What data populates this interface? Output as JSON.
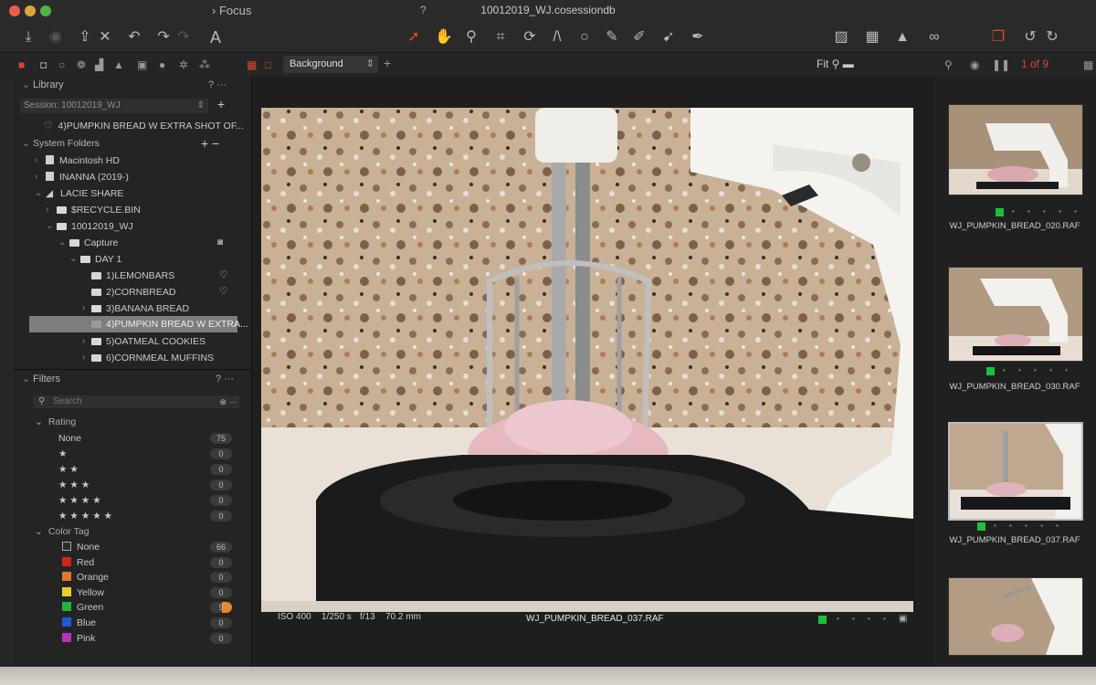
{
  "window": {
    "title": "10012019_WJ.cosessiondb",
    "focus_label": "Focus",
    "help": "?"
  },
  "toolbar": {
    "icons": [
      "import-icon",
      "camera-icon",
      "export-icon",
      "delete-icon",
      "undo-icon",
      "redo-icon",
      "text-icon",
      "select-cursor-icon",
      "pan-hand-icon",
      "zoom-icon",
      "crop-icon",
      "rotate-icon",
      "keystone-icon",
      "spot-icon",
      "brush-icon",
      "eraser-icon",
      "gradient-icon",
      "pick-icon",
      "overlay-icon",
      "grid-icon",
      "warning-icon",
      "proof-icon",
      "variants-icon",
      "rotate-left-icon",
      "rotate-right-icon"
    ]
  },
  "subbar": {
    "layer": "Background",
    "fit": "Fit",
    "counter": "1 of 9"
  },
  "library": {
    "title": "Library",
    "session": "Session: 10012019_WJ",
    "favorite": "4)PUMPKIN BREAD W EXTRA SHOT OF...",
    "system_folders": "System Folders",
    "tree": [
      {
        "label": "Macintosh HD",
        "kind": "disk"
      },
      {
        "label": "INANNA (2019-)",
        "kind": "disk"
      },
      {
        "label": "LACIE SHARE",
        "kind": "net"
      },
      {
        "label": "$RECYCLE.BIN",
        "kind": "folder"
      },
      {
        "label": "10012019_WJ",
        "kind": "folder"
      },
      {
        "label": "Capture",
        "kind": "folder"
      },
      {
        "label": "DAY 1",
        "kind": "folder"
      },
      {
        "label": "1)LEMONBARS",
        "kind": "folder"
      },
      {
        "label": "2)CORNBREAD",
        "kind": "folder"
      },
      {
        "label": "3)BANANA BREAD",
        "kind": "folder"
      },
      {
        "label": "4)PUMPKIN BREAD W EXTRA...",
        "kind": "folder"
      },
      {
        "label": "5)OATMEAL COOKIES",
        "kind": "folder"
      },
      {
        "label": "6)CORNMEAL MUFFINS",
        "kind": "folder"
      }
    ]
  },
  "filters": {
    "title": "Filters",
    "search_placeholder": "Search",
    "rating_title": "Rating",
    "ratings": [
      {
        "label": "None",
        "stars": 0,
        "count": "75"
      },
      {
        "label": "",
        "stars": 1,
        "count": "0"
      },
      {
        "label": "",
        "stars": 2,
        "count": "0"
      },
      {
        "label": "",
        "stars": 3,
        "count": "0"
      },
      {
        "label": "",
        "stars": 4,
        "count": "0"
      },
      {
        "label": "",
        "stars": 5,
        "count": "0"
      }
    ],
    "color_title": "Color Tag",
    "colors": [
      {
        "label": "None",
        "color": "#2a2a2a",
        "count": "66"
      },
      {
        "label": "Red",
        "color": "#d3241c",
        "count": "0"
      },
      {
        "label": "Orange",
        "color": "#e4772a",
        "count": "0"
      },
      {
        "label": "Yellow",
        "color": "#e9cf2a",
        "count": "0"
      },
      {
        "label": "Green",
        "color": "#22b43a",
        "count": "9"
      },
      {
        "label": "Blue",
        "color": "#1c58d8",
        "count": "0"
      },
      {
        "label": "Pink",
        "color": "#b532b8",
        "count": "0"
      }
    ]
  },
  "viewer": {
    "iso": "ISO 400",
    "shutter": "1/250 s",
    "aperture": "f/13",
    "focal": "70.2 mm",
    "filename": "WJ_PUMPKIN_BREAD_037.RAF"
  },
  "filmstrip": [
    {
      "name": "WJ_PUMPKIN_BREAD_020.RAF",
      "selected": false
    },
    {
      "name": "WJ_PUMPKIN_BREAD_030.RAF",
      "selected": false
    },
    {
      "name": "WJ_PUMPKIN_BREAD_037.RAF",
      "selected": true
    },
    {
      "name": "",
      "selected": false
    }
  ]
}
